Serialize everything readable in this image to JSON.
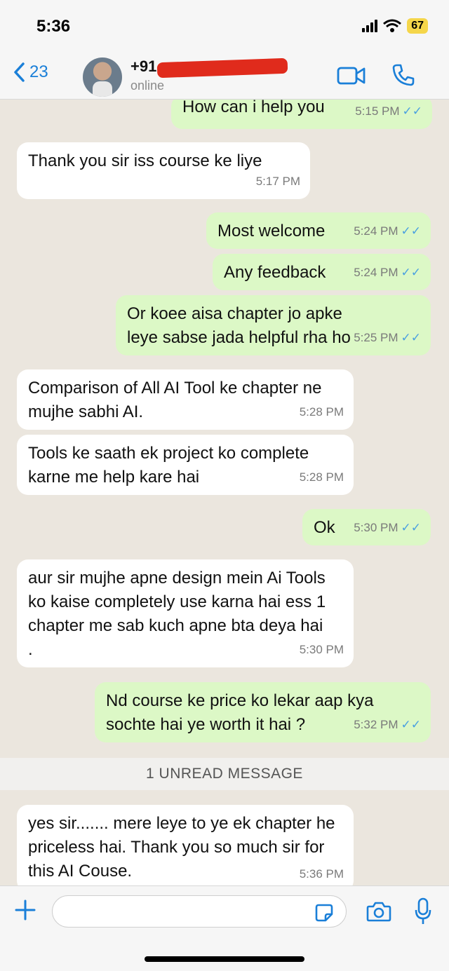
{
  "status_bar": {
    "time": "5:36",
    "battery": "67"
  },
  "header": {
    "back_count": "23",
    "contact_name": "+91",
    "contact_status": "online"
  },
  "messages": [
    {
      "dir": "out",
      "text": "How can i help you",
      "time": "5:15 PM"
    },
    {
      "dir": "in",
      "text": "Thank you sir  iss course ke liye",
      "time": "5:17 PM"
    },
    {
      "dir": "out",
      "text": "Most welcome",
      "time": "5:24 PM"
    },
    {
      "dir": "out",
      "text": "Any feedback",
      "time": "5:24 PM"
    },
    {
      "dir": "out",
      "text": "Or koee aisa chapter jo apke leye sabse jada helpful rha ho",
      "time": "5:25 PM"
    },
    {
      "dir": "in",
      "text": "Comparison of All AI Tool  ke chapter ne mujhe sabhi AI.",
      "time": "5:28 PM"
    },
    {
      "dir": "in",
      "text": "Tools ke saath ek project ko complete karne me help kare hai",
      "time": "5:28 PM"
    },
    {
      "dir": "out",
      "text": "Ok",
      "time": "5:30 PM"
    },
    {
      "dir": "in",
      "text": "aur sir mujhe apne design mein Ai Tools ko kaise completely use karna hai ess 1 chapter me sab kuch apne bta deya hai .",
      "time": "5:30 PM"
    },
    {
      "dir": "out",
      "text": "Nd course ke price ko lekar aap kya sochte hai ye worth it hai ?",
      "time": "5:32 PM"
    },
    {
      "dir": "in",
      "text": "yes sir....... mere leye to ye ek chapter he priceless hai. Thank you so much sir for this AI Couse.",
      "time": "5:36 PM"
    }
  ],
  "unread_divider": "1 UNREAD MESSAGE",
  "colors": {
    "accent": "#1a7fd8",
    "outgoing_bubble": "#dcf8c6",
    "incoming_bubble": "#ffffff",
    "read_ticks": "#4aa0e0"
  }
}
